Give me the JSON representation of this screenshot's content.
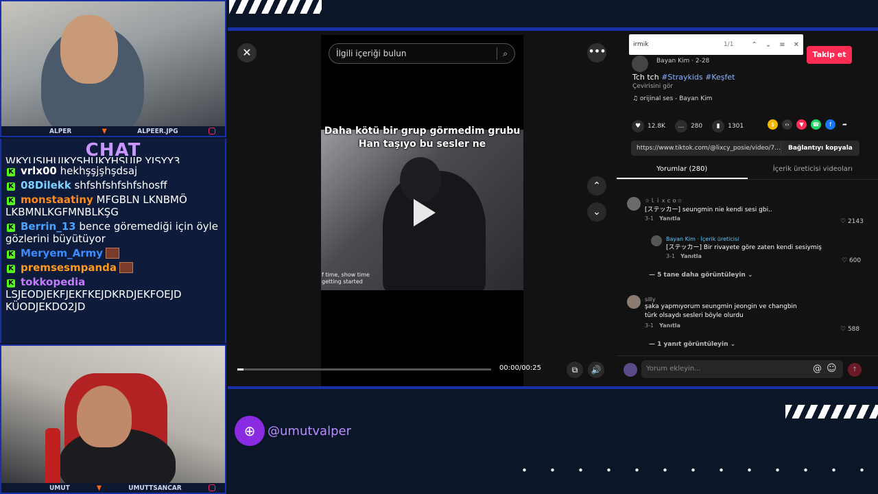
{
  "overlay": {
    "cam_top": {
      "left": "ALPER",
      "right": "ALPEER.JPG"
    },
    "cam_bottom": {
      "left": "UMUT",
      "right": "UMUTTSANCAR"
    },
    "handle": "@umutvalper"
  },
  "chat": {
    "title": "CHAT",
    "cut_line": "WKYUSIHUIKYSHUKYHSUIP YISYY3",
    "messages": [
      {
        "user": "vrlx00",
        "color": "#ffffff",
        "text": "hekhşşjşhşdsaj"
      },
      {
        "user": "08Dilekk",
        "color": "#7cd1ff",
        "text": "shfshfshfshfshosff"
      },
      {
        "user": "monstaatiny",
        "color": "#ff8a1c",
        "text": "MFGBLN LKNBMÖ LKBMNLKGFMNBLKŞG"
      },
      {
        "user": "Berrin_13",
        "color": "#4aa3ff",
        "text": "bence göremediği için öyle gözlerini büyütüyor"
      },
      {
        "user": "Meryem_Army",
        "color": "#3b8cff",
        "text": "",
        "emote": true
      },
      {
        "user": "premsesmpanda",
        "color": "#ff9a1c",
        "text": "",
        "emote": true
      },
      {
        "user": "tokkopedia",
        "color": "#c47cff",
        "text": "LSJEODJEKFJEKFKEJDKRDJEKFOEJD KÜODJEKDO2JD"
      }
    ]
  },
  "video": {
    "search_placeholder": "İlgili içeriği bulun",
    "caption": "Daha kötü bir grup görmedim grubu Han taşıyo bu sesler ne",
    "sub_line1": "f time, show time",
    "sub_line2": "getting started",
    "time": "00:00/00:25",
    "progress_fraction": 0.025
  },
  "side": {
    "find_text": "irmik",
    "find_count": "1/1",
    "follow_label": "Takip et",
    "author": "Bayan Kim · 2-28",
    "desc_text": "Tch tch ",
    "desc_tags": "#Straykids #Keşfet",
    "translate": "Çevirisini gör",
    "sound": "♫  orijinal ses - Bayan Kim",
    "stats": {
      "likes": "12.8K",
      "comments": "280",
      "saves": "1301"
    },
    "link": "https://www.tiktok.com/@lixcy_posie/video/7...",
    "copy_label": "Bağlantıyı kopyala",
    "tabs": {
      "comments": "Yorumlar (280)",
      "creator": "İçerik üreticisi videoları"
    },
    "comments": [
      {
        "name": "☆ｌｉｘｃｏ☆",
        "text": "[ステッカー] seungmin nie kendi sesi gbi..",
        "date": "3-1",
        "reply": "Yanıtla",
        "likes": "2143"
      },
      {
        "name": "Bayan Kim · İçerik üreticisi",
        "text": "[ステッカー] Bir rivayete göre zaten kendi sesiymiş",
        "date": "3-1",
        "reply": "Yanıtla",
        "likes": "600"
      },
      {
        "name": "silly",
        "text": "şaka yapmıyorum seungmin jeongin ve changbin türk olsaydı sesleri böyle olurdu",
        "date": "3-1",
        "reply": "Yanıtla",
        "likes": "588"
      }
    ],
    "more_replies_1": "—  5 tane daha görüntüleyin ⌄",
    "more_replies_2": "—  1 yanıt görüntüleyin ⌄",
    "comment_placeholder": "Yorum ekleyin..."
  }
}
